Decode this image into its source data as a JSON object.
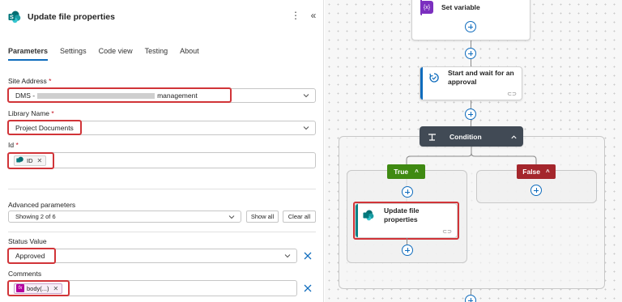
{
  "panel": {
    "title": "Update file properties",
    "more_icon": "more-vertical-icon",
    "collapse_icon": "collapse-double-chevron-icon",
    "tabs": [
      {
        "label": "Parameters",
        "active": true
      },
      {
        "label": "Settings",
        "active": false
      },
      {
        "label": "Code view",
        "active": false
      },
      {
        "label": "Testing",
        "active": false
      },
      {
        "label": "About",
        "active": false
      }
    ],
    "site_address": {
      "label": "Site Address",
      "value_prefix": "DMS - ",
      "value_suffix": "management"
    },
    "library_name": {
      "label": "Library Name",
      "value": "Project Documents"
    },
    "id": {
      "label": "Id",
      "token": "ID"
    },
    "advanced": {
      "label": "Advanced parameters",
      "showing": "Showing 2 of 6",
      "show_all": "Show all",
      "clear_all": "Clear all"
    },
    "status_value": {
      "label": "Status Value",
      "value": "Approved"
    },
    "comments": {
      "label": "Comments",
      "token": "body(...)"
    },
    "required_mark": "*"
  },
  "canvas": {
    "set_variable": {
      "title": "Set variable",
      "icon": "variable-icon"
    },
    "approval": {
      "title": "Start and wait for an approval",
      "icon": "approval-icon"
    },
    "condition": {
      "title": "Condition",
      "icon": "condition-icon"
    },
    "true_branch": {
      "label": "True"
    },
    "false_branch": {
      "label": "False"
    },
    "update_file": {
      "title": "Update file properties",
      "icon": "sharepoint-icon"
    }
  },
  "colors": {
    "accent_blue": "#0f6cbd",
    "highlight_red": "#d13438",
    "condition_dark": "#414a55",
    "true_green": "#3f8a12",
    "false_red": "#a4262c",
    "variable_purple": "#7b2fbf",
    "sharepoint_teal": "#038387"
  }
}
